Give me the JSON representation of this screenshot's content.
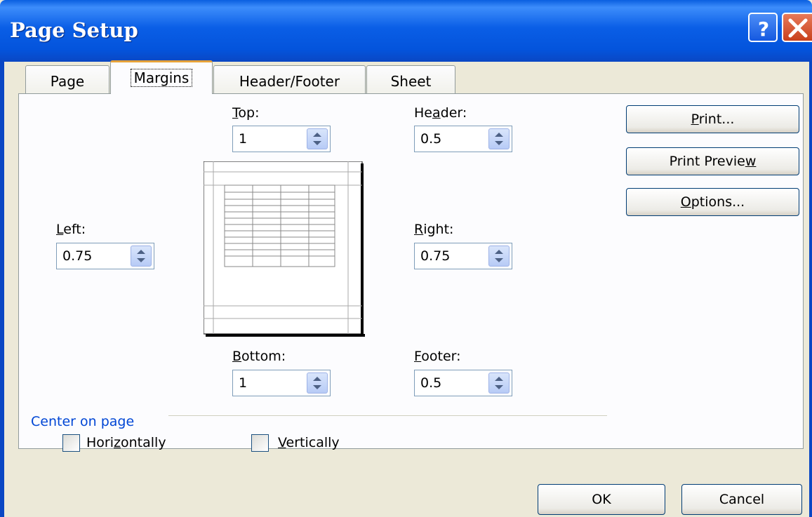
{
  "window": {
    "title": "Page Setup"
  },
  "tabs": [
    {
      "label": "Page"
    },
    {
      "label": "Margins"
    },
    {
      "label": "Header/Footer"
    },
    {
      "label": "Sheet"
    }
  ],
  "margins": {
    "top": {
      "label": "Top:",
      "accel": "T",
      "rest": "op:",
      "value": "1"
    },
    "header": {
      "label": "Header:",
      "pre": "He",
      "accel": "a",
      "rest": "der:",
      "value": "0.5"
    },
    "left": {
      "label": "Left:",
      "accel": "L",
      "rest": "eft:",
      "value": "0.75"
    },
    "right": {
      "label": "Right:",
      "accel": "R",
      "rest": "ight:",
      "value": "0.75"
    },
    "bottom": {
      "label": "Bottom:",
      "accel": "B",
      "rest": "ottom:",
      "value": "1"
    },
    "footer": {
      "label": "Footer:",
      "accel": "F",
      "rest": "ooter:",
      "value": "0.5"
    }
  },
  "actions": {
    "print": {
      "accel": "P",
      "rest": "rint..."
    },
    "preview": {
      "pre": "Print Previe",
      "accel": "w"
    },
    "options": {
      "accel": "O",
      "rest": "ptions..."
    }
  },
  "center_on_page": {
    "title": "Center on page",
    "horizontally": {
      "pre": "Hori",
      "accel": "z",
      "rest": "ontally",
      "checked": false
    },
    "vertically": {
      "accel": "V",
      "rest": "ertically",
      "checked": false
    }
  },
  "footer_buttons": {
    "ok": "OK",
    "cancel": "Cancel"
  },
  "colors": {
    "titlebar": "#0a5ee6",
    "dialog": "#ece9d8",
    "group_title": "#0046d5"
  }
}
